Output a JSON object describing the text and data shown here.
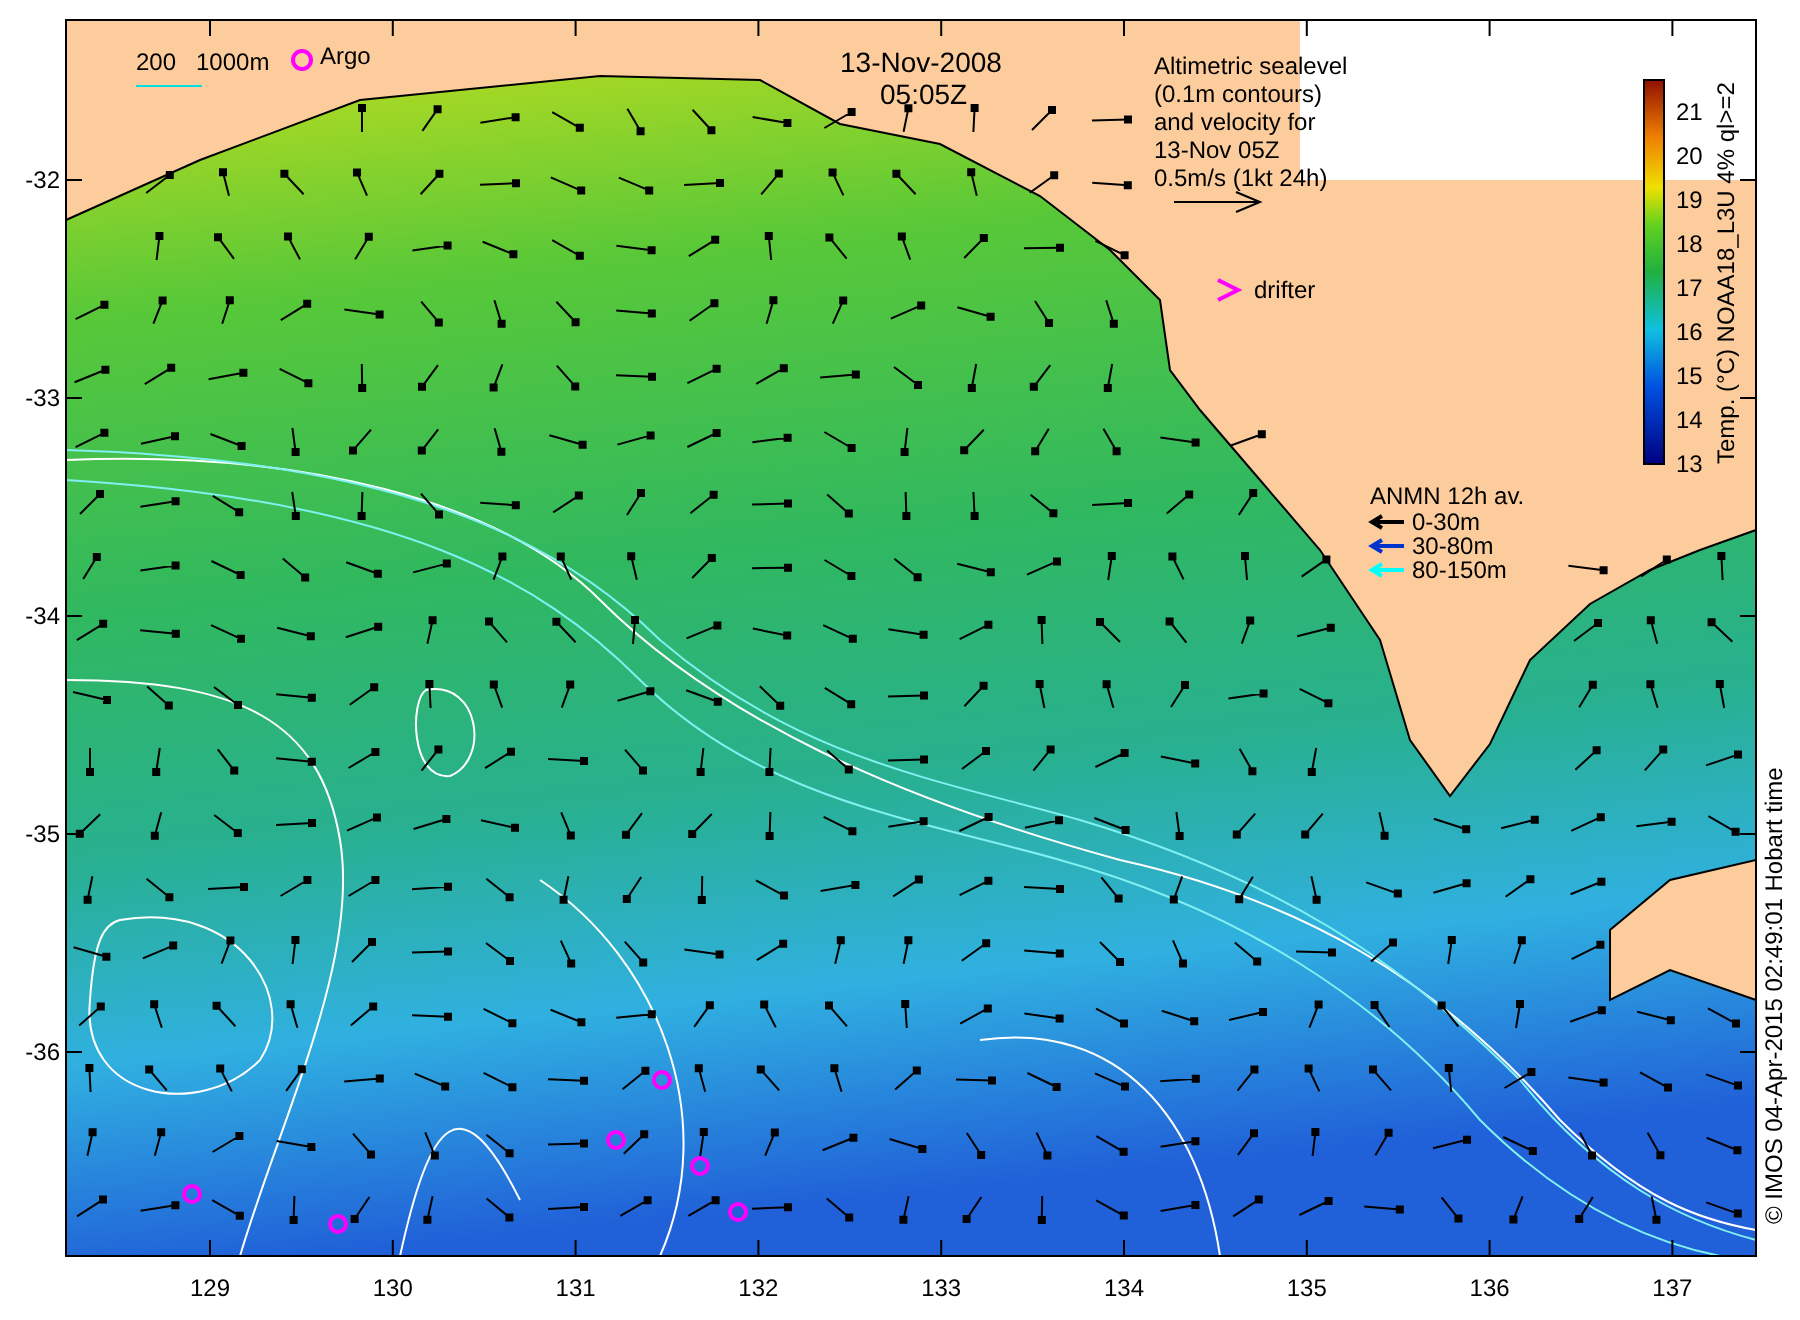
{
  "map": {
    "date": "13-Nov-2008",
    "time": "05:05Z",
    "scale_legend": [
      "200",
      "1000m"
    ],
    "argo_label": "Argo",
    "altimetry_note": [
      "Altimetric sealevel",
      "(0.1m contours)",
      "and velocity for",
      "13-Nov 05Z",
      "0.5m/s (1kt 24h)"
    ],
    "drifter_label": "drifter",
    "anmn_legend": {
      "title": "ANMN 12h av.",
      "items": [
        {
          "label": "0-30m",
          "color": "#000000"
        },
        {
          "label": "30-80m",
          "color": "#0033cc"
        },
        {
          "label": "80-150m",
          "color": "#00ffff"
        }
      ]
    },
    "colorbar": {
      "title": "Temp. (°C) NOAA18_L3U 4% ql>=2",
      "ticks": [
        "21",
        "20",
        "19",
        "18",
        "17",
        "16",
        "15",
        "14",
        "13"
      ]
    },
    "credit": "© IMOS 04-Apr-2015 02:49:01 Hobart time",
    "y_ticks": [
      "-32",
      "-33",
      "-34",
      "-35",
      "-36"
    ],
    "x_ticks": [
      "129",
      "130",
      "131",
      "132",
      "133",
      "134",
      "135",
      "136",
      "137"
    ]
  }
}
